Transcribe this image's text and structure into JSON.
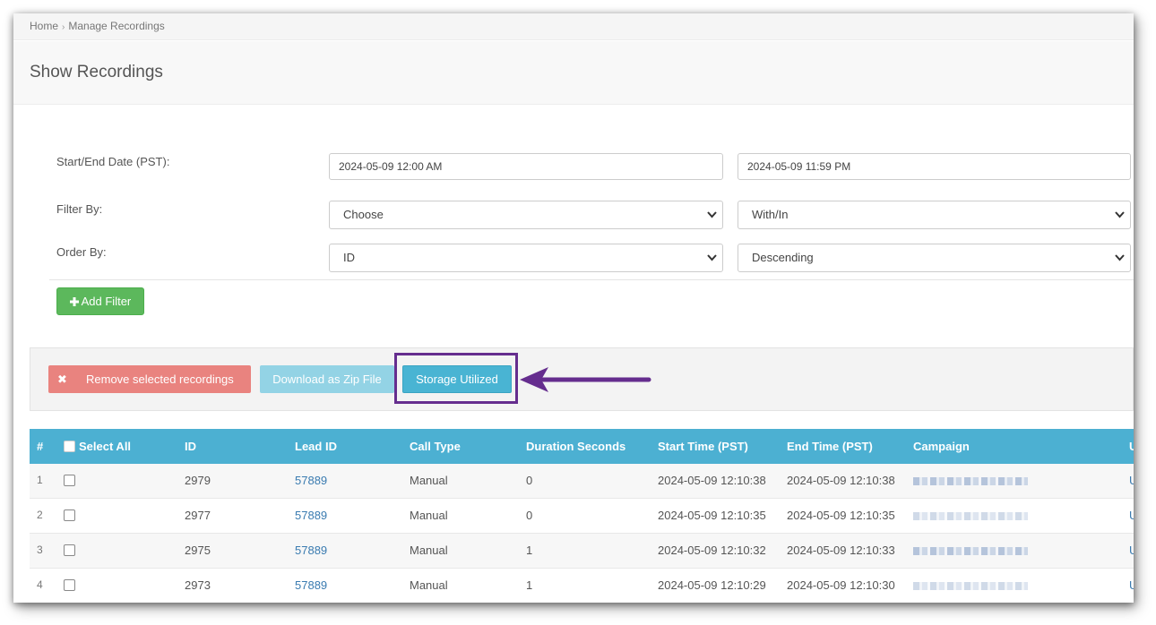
{
  "breadcrumb": {
    "home": "Home",
    "separator": "›",
    "current": "Manage Recordings"
  },
  "page": {
    "title": "Show Recordings"
  },
  "filters": {
    "date_label": "Start/End Date (PST):",
    "start_date": "2024-05-09 12:00 AM",
    "end_date": "2024-05-09 11:59 PM",
    "filter_label": "Filter By:",
    "filter_field": "Choose",
    "filter_op": "With/In",
    "order_label": "Order By:",
    "order_field": "ID",
    "order_dir": "Descending",
    "add_filter_icon": "plus-icon",
    "add_filter": "Add Filter"
  },
  "actions": {
    "remove_icon": "times-icon",
    "remove": "Remove selected recordings",
    "download": "Download as Zip File",
    "storage": "Storage Utilized"
  },
  "table": {
    "headers": [
      "#",
      "Select All",
      "ID",
      "Lead ID",
      "Call Type",
      "Duration Seconds",
      "Start Time (PST)",
      "End Time (PST)",
      "Campaign",
      "U"
    ],
    "rows": [
      {
        "n": "1",
        "id": "2979",
        "lead": "57889",
        "type": "Manual",
        "dur": "0",
        "start": "2024-05-09 12:10:38",
        "end": "2024-05-09 12:10:38",
        "u": "U"
      },
      {
        "n": "2",
        "id": "2977",
        "lead": "57889",
        "type": "Manual",
        "dur": "0",
        "start": "2024-05-09 12:10:35",
        "end": "2024-05-09 12:10:35",
        "u": "U"
      },
      {
        "n": "3",
        "id": "2975",
        "lead": "57889",
        "type": "Manual",
        "dur": "1",
        "start": "2024-05-09 12:10:32",
        "end": "2024-05-09 12:10:33",
        "u": "U"
      },
      {
        "n": "4",
        "id": "2973",
        "lead": "57889",
        "type": "Manual",
        "dur": "1",
        "start": "2024-05-09 12:10:29",
        "end": "2024-05-09 12:10:30",
        "u": "U"
      }
    ]
  },
  "colors": {
    "table_header": "#4cb0d2",
    "add_filter": "#5cb85c",
    "remove": "#e9837f",
    "download": "#93d3e5",
    "storage": "#49b4d3",
    "annotation": "#652d8e"
  }
}
